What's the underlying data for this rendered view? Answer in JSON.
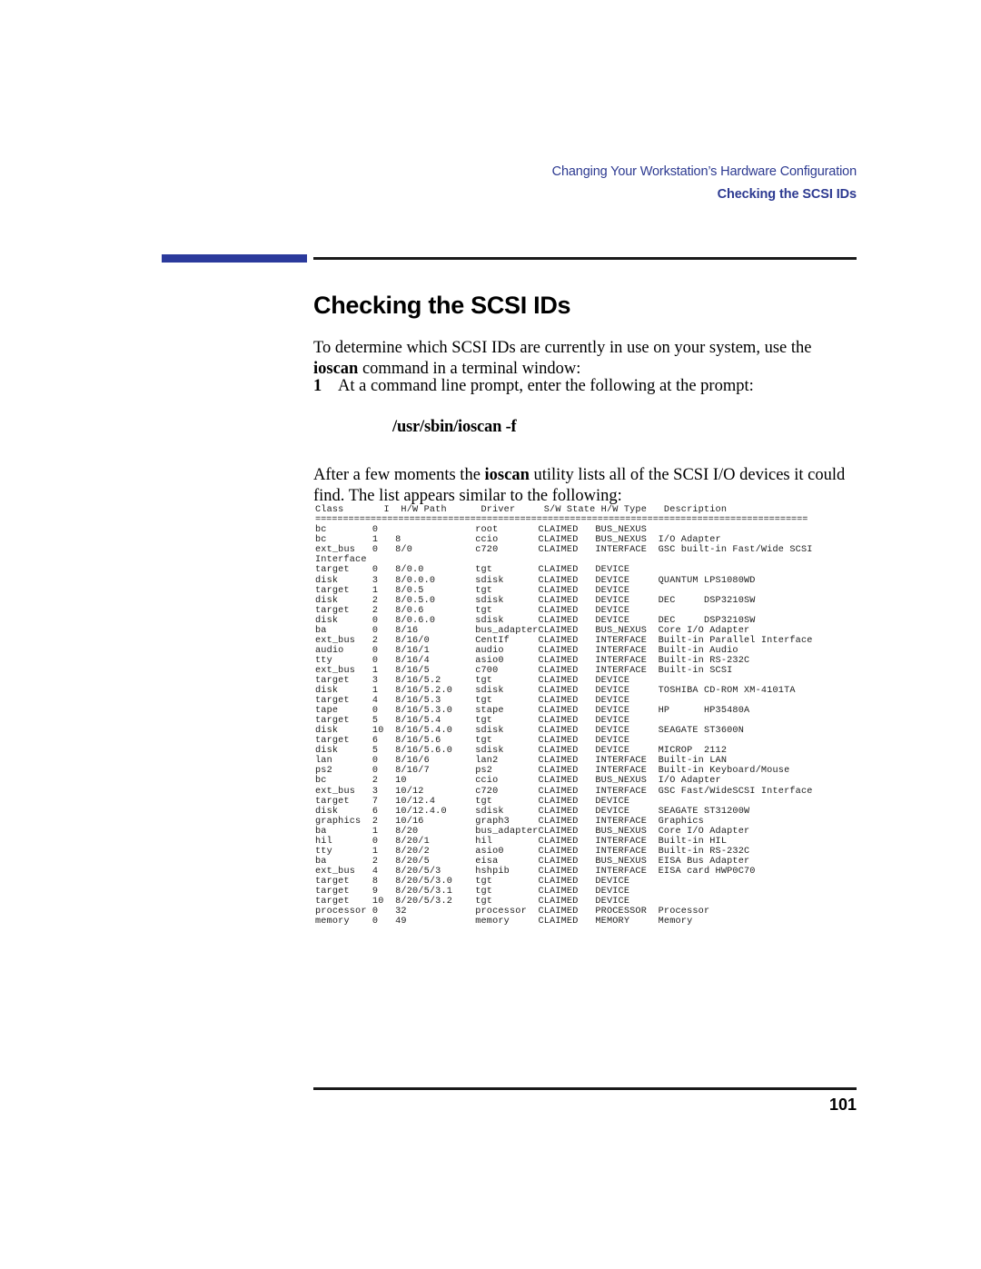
{
  "header": {
    "chapter_title": "Changing Your Workstation’s Hardware Configuration",
    "section_title": "Checking the SCSI IDs",
    "accent_color": "#2b3a9c",
    "header_text_color": "#2d3a91"
  },
  "page_title": "Checking the SCSI IDs",
  "body": {
    "intro_part1": "To determine which SCSI IDs are currently in use on your system, use the ",
    "intro_bold": "ioscan",
    "intro_part2": " command in a terminal window:",
    "step_number": "1",
    "step_text": "At a command line prompt, enter the following at the prompt:",
    "command": "/usr/sbin/ioscan -f",
    "after_part1": "After a few moments the ",
    "after_bold": "ioscan",
    "after_part2": " utility lists all of the SCSI I/O devices it could find. The list appears similar to the following:"
  },
  "listing": {
    "columns": [
      "Class",
      "I",
      "H/W Path",
      "Driver",
      "S/W State",
      "H/W Type",
      "Description"
    ],
    "header_line": "Class       I  H/W Path      Driver     S/W State H/W Type   Description",
    "separator_line": "=========================================================================================",
    "rows": [
      {
        "class": "bc",
        "i": "0",
        "hw_path": "",
        "driver": "root",
        "sw_state": "CLAIMED",
        "hw_type": "BUS_NEXUS",
        "description": ""
      },
      {
        "class": "bc",
        "i": "1",
        "hw_path": "8",
        "driver": "ccio",
        "sw_state": "CLAIMED",
        "hw_type": "BUS_NEXUS",
        "description": "I/O Adapter"
      },
      {
        "class": "ext_bus",
        "i": "0",
        "hw_path": "8/0",
        "driver": "c720",
        "sw_state": "CLAIMED",
        "hw_type": "INTERFACE",
        "description": "GSC built-in Fast/Wide SCSI"
      },
      {
        "class": "",
        "i": "",
        "hw_path": "",
        "driver": "",
        "sw_state": "",
        "hw_type": "",
        "description": "",
        "raw": "Interface"
      },
      {
        "class": "target",
        "i": "0",
        "hw_path": "8/0.0",
        "driver": "tgt",
        "sw_state": "CLAIMED",
        "hw_type": "DEVICE",
        "description": ""
      },
      {
        "class": "disk",
        "i": "3",
        "hw_path": "8/0.0.0",
        "driver": "sdisk",
        "sw_state": "CLAIMED",
        "hw_type": "DEVICE",
        "description": "QUANTUM LPS1080WD"
      },
      {
        "class": "target",
        "i": "1",
        "hw_path": "8/0.5",
        "driver": "tgt",
        "sw_state": "CLAIMED",
        "hw_type": "DEVICE",
        "description": ""
      },
      {
        "class": "disk",
        "i": "2",
        "hw_path": "8/0.5.0",
        "driver": "sdisk",
        "sw_state": "CLAIMED",
        "hw_type": "DEVICE",
        "description": "DEC     DSP3210SW"
      },
      {
        "class": "target",
        "i": "2",
        "hw_path": "8/0.6",
        "driver": "tgt",
        "sw_state": "CLAIMED",
        "hw_type": "DEVICE",
        "description": ""
      },
      {
        "class": "disk",
        "i": "0",
        "hw_path": "8/0.6.0",
        "driver": "sdisk",
        "sw_state": "CLAIMED",
        "hw_type": "DEVICE",
        "description": "DEC     DSP3210SW"
      },
      {
        "class": "ba",
        "i": "0",
        "hw_path": "8/16",
        "driver": "bus_adapter",
        "sw_state": "CLAIMED",
        "hw_type": "BUS_NEXUS",
        "description": "Core I/O Adapter"
      },
      {
        "class": "ext_bus",
        "i": "2",
        "hw_path": "8/16/0",
        "driver": "CentIf",
        "sw_state": "CLAIMED",
        "hw_type": "INTERFACE",
        "description": "Built-in Parallel Interface"
      },
      {
        "class": "audio",
        "i": "0",
        "hw_path": "8/16/1",
        "driver": "audio",
        "sw_state": "CLAIMED",
        "hw_type": "INTERFACE",
        "description": "Built-in Audio"
      },
      {
        "class": "tty",
        "i": "0",
        "hw_path": "8/16/4",
        "driver": "asio0",
        "sw_state": "CLAIMED",
        "hw_type": "INTERFACE",
        "description": "Built-in RS-232C"
      },
      {
        "class": "ext_bus",
        "i": "1",
        "hw_path": "8/16/5",
        "driver": "c700",
        "sw_state": "CLAIMED",
        "hw_type": "INTERFACE",
        "description": "Built-in SCSI"
      },
      {
        "class": "target",
        "i": "3",
        "hw_path": "8/16/5.2",
        "driver": "tgt",
        "sw_state": "CLAIMED",
        "hw_type": "DEVICE",
        "description": ""
      },
      {
        "class": "disk",
        "i": "1",
        "hw_path": "8/16/5.2.0",
        "driver": "sdisk",
        "sw_state": "CLAIMED",
        "hw_type": "DEVICE",
        "description": "TOSHIBA CD-ROM XM-4101TA"
      },
      {
        "class": "target",
        "i": "4",
        "hw_path": "8/16/5.3",
        "driver": "tgt",
        "sw_state": "CLAIMED",
        "hw_type": "DEVICE",
        "description": ""
      },
      {
        "class": "tape",
        "i": "0",
        "hw_path": "8/16/5.3.0",
        "driver": "stape",
        "sw_state": "CLAIMED",
        "hw_type": "DEVICE",
        "description": "HP      HP35480A"
      },
      {
        "class": "target",
        "i": "5",
        "hw_path": "8/16/5.4",
        "driver": "tgt",
        "sw_state": "CLAIMED",
        "hw_type": "DEVICE",
        "description": ""
      },
      {
        "class": "disk",
        "i": "10",
        "hw_path": "8/16/5.4.0",
        "driver": "sdisk",
        "sw_state": "CLAIMED",
        "hw_type": "DEVICE",
        "description": "SEAGATE ST3600N"
      },
      {
        "class": "target",
        "i": "6",
        "hw_path": "8/16/5.6",
        "driver": "tgt",
        "sw_state": "CLAIMED",
        "hw_type": "DEVICE",
        "description": ""
      },
      {
        "class": "disk",
        "i": "5",
        "hw_path": "8/16/5.6.0",
        "driver": "sdisk",
        "sw_state": "CLAIMED",
        "hw_type": "DEVICE",
        "description": "MICROP  2112"
      },
      {
        "class": "lan",
        "i": "0",
        "hw_path": "8/16/6",
        "driver": "lan2",
        "sw_state": "CLAIMED",
        "hw_type": "INTERFACE",
        "description": "Built-in LAN"
      },
      {
        "class": "ps2",
        "i": "0",
        "hw_path": "8/16/7",
        "driver": "ps2",
        "sw_state": "CLAIMED",
        "hw_type": "INTERFACE",
        "description": "Built-in Keyboard/Mouse"
      },
      {
        "class": "bc",
        "i": "2",
        "hw_path": "10",
        "driver": "ccio",
        "sw_state": "CLAIMED",
        "hw_type": "BUS_NEXUS",
        "description": "I/O Adapter"
      },
      {
        "class": "ext_bus",
        "i": "3",
        "hw_path": "10/12",
        "driver": "c720",
        "sw_state": "CLAIMED",
        "hw_type": "INTERFACE",
        "description": "GSC Fast/WideSCSI Interface"
      },
      {
        "class": "target",
        "i": "7",
        "hw_path": "10/12.4",
        "driver": "tgt",
        "sw_state": "CLAIMED",
        "hw_type": "DEVICE",
        "description": ""
      },
      {
        "class": "disk",
        "i": "6",
        "hw_path": "10/12.4.0",
        "driver": "sdisk",
        "sw_state": "CLAIMED",
        "hw_type": "DEVICE",
        "description": "SEAGATE ST31200W"
      },
      {
        "class": "graphics",
        "i": "2",
        "hw_path": "10/16",
        "driver": "graph3",
        "sw_state": "CLAIMED",
        "hw_type": "INTERFACE",
        "description": "Graphics"
      },
      {
        "class": "ba",
        "i": "1",
        "hw_path": "8/20",
        "driver": "bus_adapter",
        "sw_state": "CLAIMED",
        "hw_type": "BUS_NEXUS",
        "description": "Core I/O Adapter"
      },
      {
        "class": "hil",
        "i": "0",
        "hw_path": "8/20/1",
        "driver": "hil",
        "sw_state": "CLAIMED",
        "hw_type": "INTERFACE",
        "description": "Built-in HIL"
      },
      {
        "class": "tty",
        "i": "1",
        "hw_path": "8/20/2",
        "driver": "asio0",
        "sw_state": "CLAIMED",
        "hw_type": "INTERFACE",
        "description": "Built-in RS-232C"
      },
      {
        "class": "ba",
        "i": "2",
        "hw_path": "8/20/5",
        "driver": "eisa",
        "sw_state": "CLAIMED",
        "hw_type": "BUS_NEXUS",
        "description": "EISA Bus Adapter"
      },
      {
        "class": "ext_bus",
        "i": "4",
        "hw_path": "8/20/5/3",
        "driver": "hshpib",
        "sw_state": "CLAIMED",
        "hw_type": "INTERFACE",
        "description": "EISA card HWP0C70"
      },
      {
        "class": "target",
        "i": "8",
        "hw_path": "8/20/5/3.0",
        "driver": "tgt",
        "sw_state": "CLAIMED",
        "hw_type": "DEVICE",
        "description": ""
      },
      {
        "class": "target",
        "i": "9",
        "hw_path": "8/20/5/3.1",
        "driver": "tgt",
        "sw_state": "CLAIMED",
        "hw_type": "DEVICE",
        "description": ""
      },
      {
        "class": "target",
        "i": "10",
        "hw_path": "8/20/5/3.2",
        "driver": "tgt",
        "sw_state": "CLAIMED",
        "hw_type": "DEVICE",
        "description": ""
      },
      {
        "class": "processor",
        "i": "0",
        "hw_path": "32",
        "driver": "processor",
        "sw_state": "CLAIMED",
        "hw_type": "PROCESSOR",
        "description": "Processor"
      },
      {
        "class": "memory",
        "i": "0",
        "hw_path": "49",
        "driver": "memory",
        "sw_state": "CLAIMED",
        "hw_type": "MEMORY",
        "description": "Memory"
      }
    ]
  },
  "footer": {
    "page_number": "101"
  }
}
